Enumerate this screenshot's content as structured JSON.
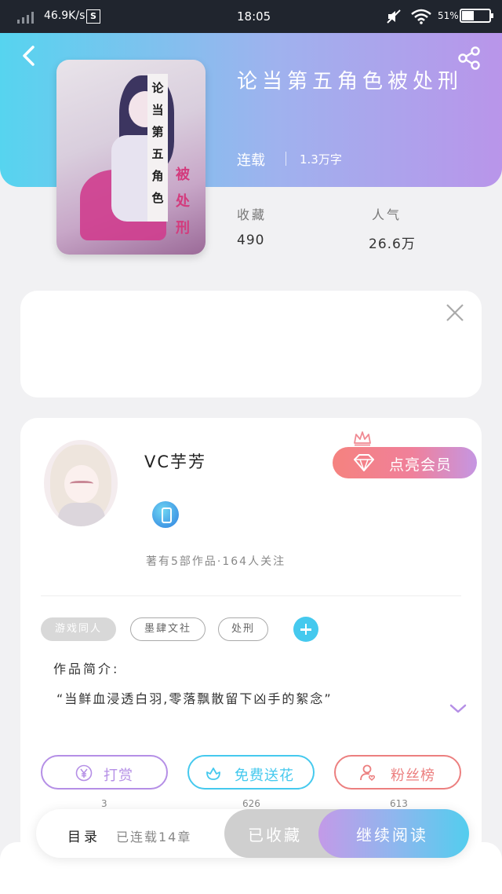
{
  "status_bar": {
    "speed": "46.9K/s",
    "s_badge": "S",
    "time": "18:05",
    "battery": "51%"
  },
  "book": {
    "title": "论当第五角色被处刑",
    "status": "连载",
    "word_count": "1.3万字",
    "cover_text_main": "论当第五角色",
    "cover_text_sub": "被处刑"
  },
  "stats": {
    "favorites_label": "收藏",
    "favorites_value": "490",
    "popularity_label": "人气",
    "popularity_value": "26.6万"
  },
  "author": {
    "name": "VC芋芳",
    "meta": "著有5部作品·164人关注",
    "vip_label": "点亮会员"
  },
  "tags": [
    "游戏同人",
    "墨肆文社",
    "处刑"
  ],
  "intro": {
    "label": "作品简介:",
    "text": "“当鲜血浸透白羽,零落飘散留下凶手的絮念”"
  },
  "actions": {
    "tip_label": "打赏",
    "tip_count": "3",
    "flower_label": "免费送花",
    "flower_count": "626",
    "fans_label": "粉丝榜",
    "fans_count": "613"
  },
  "bottom": {
    "toc_label": "目录",
    "toc_count": "已连载14章",
    "collected_label": "已收藏",
    "read_label": "继续阅读"
  },
  "colors": {
    "header_start": "#56d4ef",
    "header_end": "#b995ea",
    "tip_purple": "#b58fe6",
    "flower_cyan": "#45c9ee",
    "fans_coral": "#ec7f7f"
  }
}
